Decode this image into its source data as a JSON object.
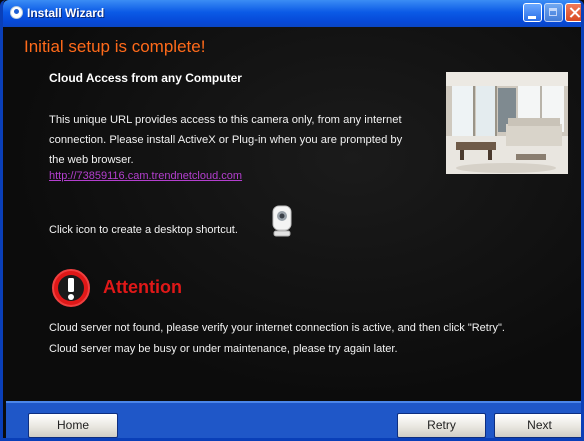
{
  "window": {
    "title": "Install Wizard"
  },
  "page": {
    "heading": "Initial setup is complete!",
    "cloud_title": "Cloud Access from any Computer",
    "description_lines": [
      "This unique URL provides access to this camera only, from any internet",
      "connection. Please install ActiveX or Plug-in when you are prompted by",
      "the web browser."
    ],
    "url": "http://73859116.cam.trendnetcloud.com",
    "shortcut_text": "Click icon to create a desktop shortcut.",
    "attention_label": "Attention",
    "messages": [
      "Cloud server not found, please verify your internet connection is active, and then click \"Retry\".",
      "Cloud server may be busy or under maintenance, please try again later."
    ]
  },
  "buttons": {
    "home": "Home",
    "retry": "Retry",
    "next": "Next"
  },
  "icons": {
    "title": "install-wizard-icon",
    "camera": "camera-shortcut-icon",
    "attention": "attention-icon"
  },
  "colors": {
    "heading": "#ff6a1a",
    "attention": "#e01818",
    "link": "#b43fcf",
    "titlebar": "#0b5ae6",
    "footer": "#1f57c8"
  }
}
